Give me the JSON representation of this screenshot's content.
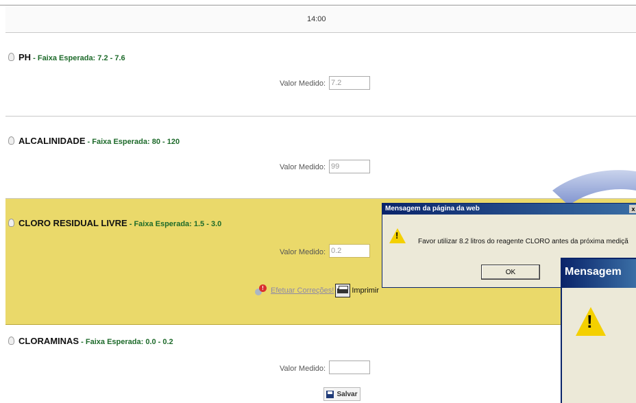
{
  "header": {
    "time": "14:00"
  },
  "sections": [
    {
      "name": "PH",
      "range": "Faixa Esperada: 7.2 - 7.6",
      "value_label": "Valor Medido:",
      "value": "7.2"
    },
    {
      "name": "ALCALINIDADE",
      "range": "Faixa Esperada: 80 - 120",
      "value_label": "Valor Medido:",
      "value": "99"
    },
    {
      "name": "CLORO RESIDUAL LIVRE",
      "range": "Faixa Esperada: 1.5 - 3.0",
      "value_label": "Valor Medido:",
      "value": "0.2",
      "highlight_color": "#ead96a"
    },
    {
      "name": "CLORAMINAS",
      "range": "Faixa Esperada: 0.0 - 0.2",
      "value_label": "Valor Medido:",
      "value": ""
    }
  ],
  "actions": {
    "corrections_label": "Efetuar Correções!",
    "print_label": "Imprimir"
  },
  "save_label": "Salvar",
  "separator": " - ",
  "dialog": {
    "title": "Mensagem da página da web",
    "close": "x",
    "message": "Favor utilizar 8.2 litros do reagente CLORO antes da próxima mediçã",
    "ok_label": "OK"
  },
  "zoom_dialog": {
    "title": "Mensagem"
  },
  "colors": {
    "highlight": "#ead96a",
    "range_text": "#1d6a2a",
    "dialog_title": "#0a246a"
  }
}
